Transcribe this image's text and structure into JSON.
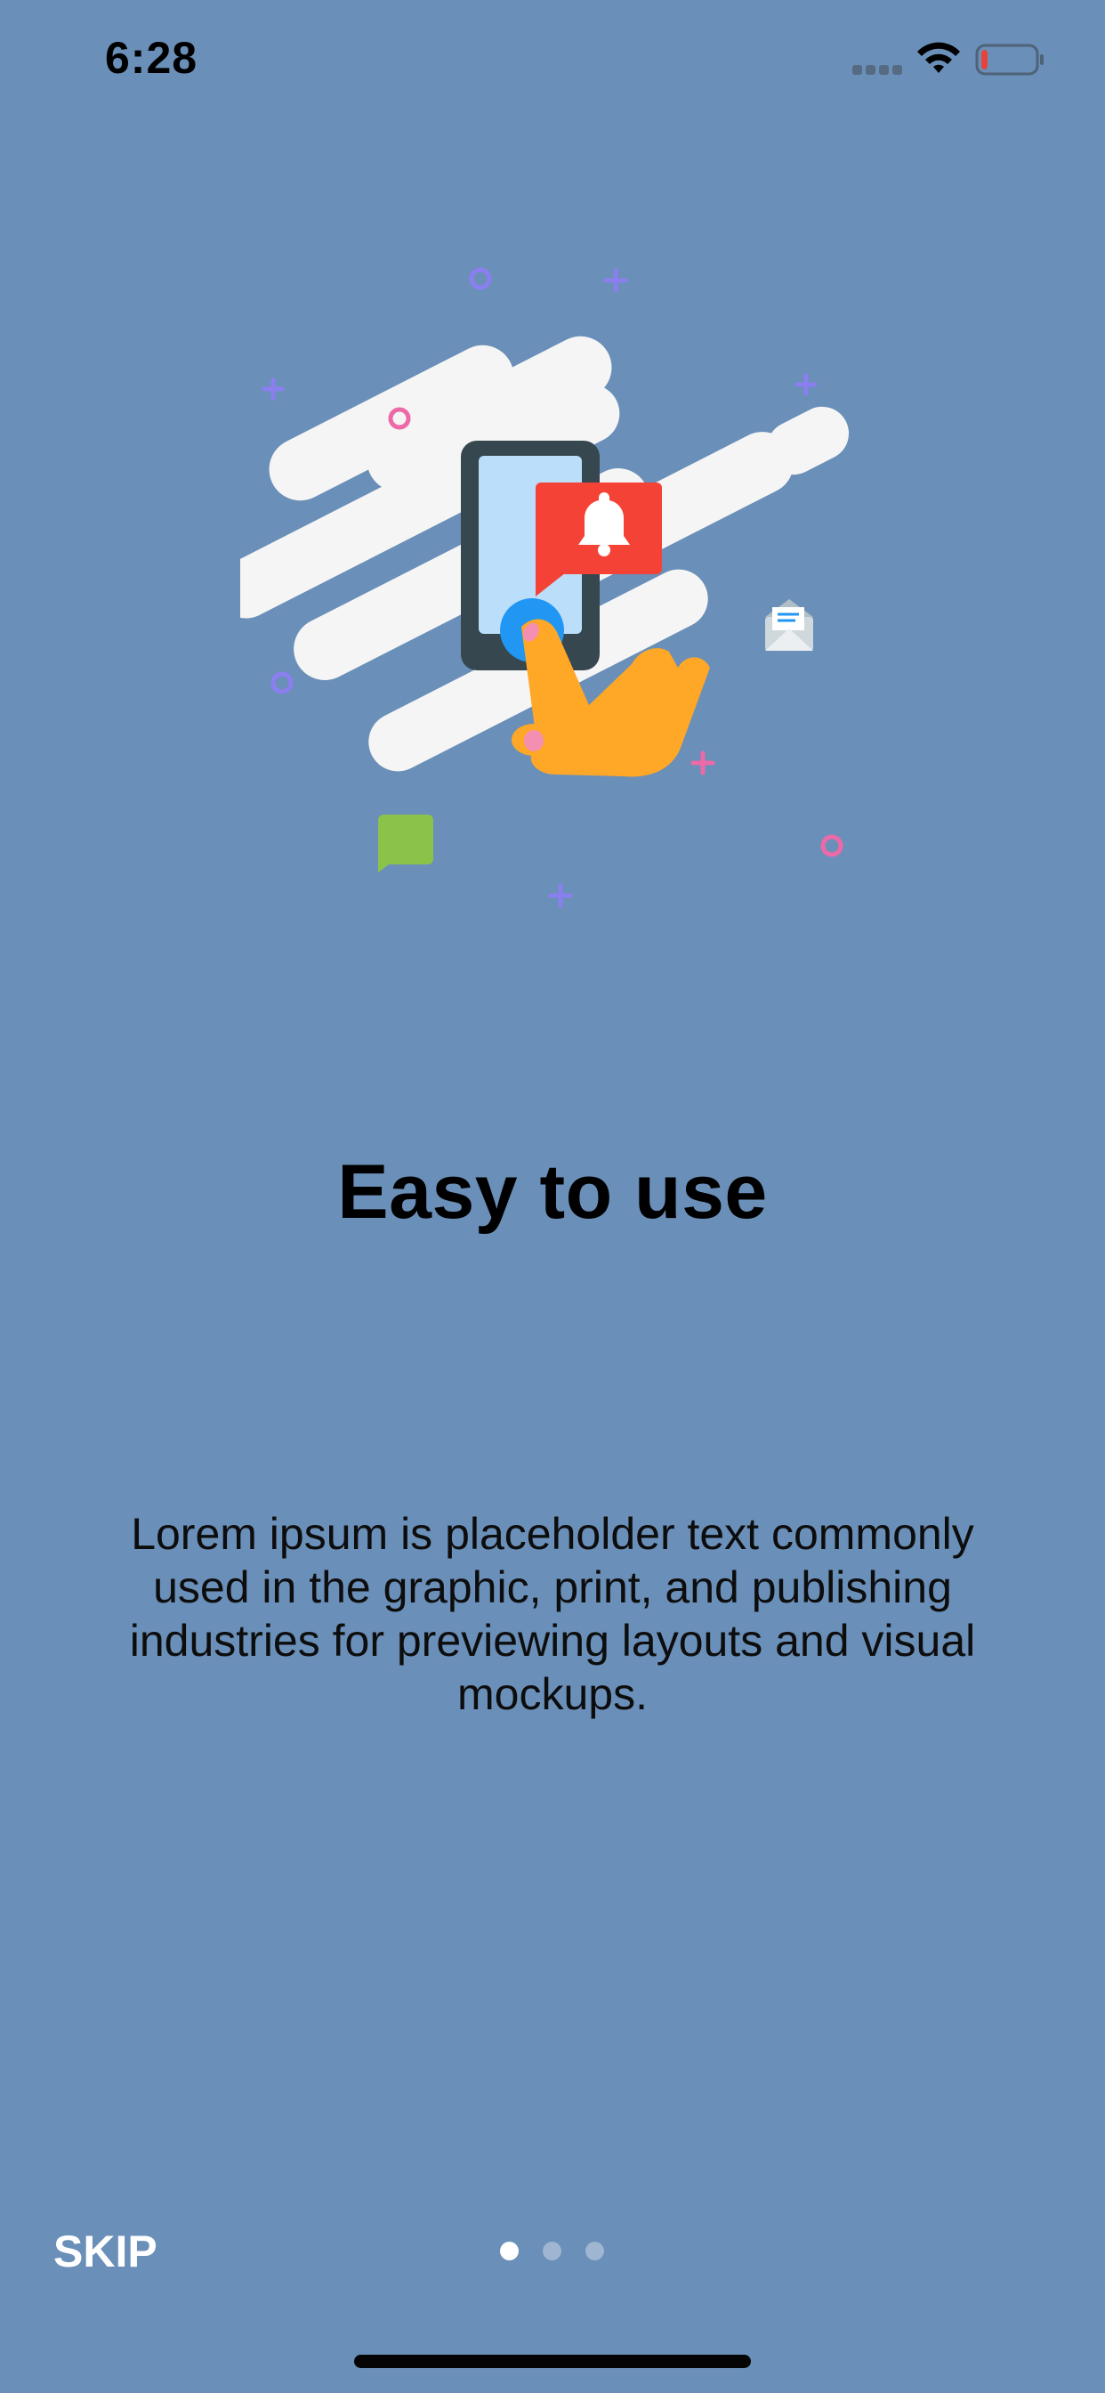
{
  "status_bar": {
    "time": "6:28",
    "signal_icon": "signal-dots-icon",
    "wifi_icon": "wifi-icon",
    "battery_icon": "battery-low-icon",
    "battery_level": 0.12,
    "battery_color": "#e8433a"
  },
  "illustration": {
    "icon": "phone-notification-hand-illustration",
    "colors": {
      "cloud": "#f5f5f5",
      "phone": "#37474f",
      "screen": "#bbdefb",
      "bubble": "#f44336",
      "hand": "#ffa726",
      "button": "#2196f3",
      "chat": "#8bc34a",
      "pink": "#ec6aa8",
      "purple": "#8b7ff0"
    }
  },
  "onboarding": {
    "title": "Easy to use",
    "description": "Lorem ipsum is placeholder text commonly used in the graphic, print, and publishing industries for previewing layouts and visual mockups."
  },
  "footer": {
    "skip_label": "SKIP",
    "pages": 3,
    "current_page": 1
  },
  "colors": {
    "background": "#6a8fb8",
    "text": "#000000",
    "skip": "#ffffff",
    "dot_active": "#ffffff",
    "dot_inactive": "rgba(255,255,255,0.35)"
  }
}
